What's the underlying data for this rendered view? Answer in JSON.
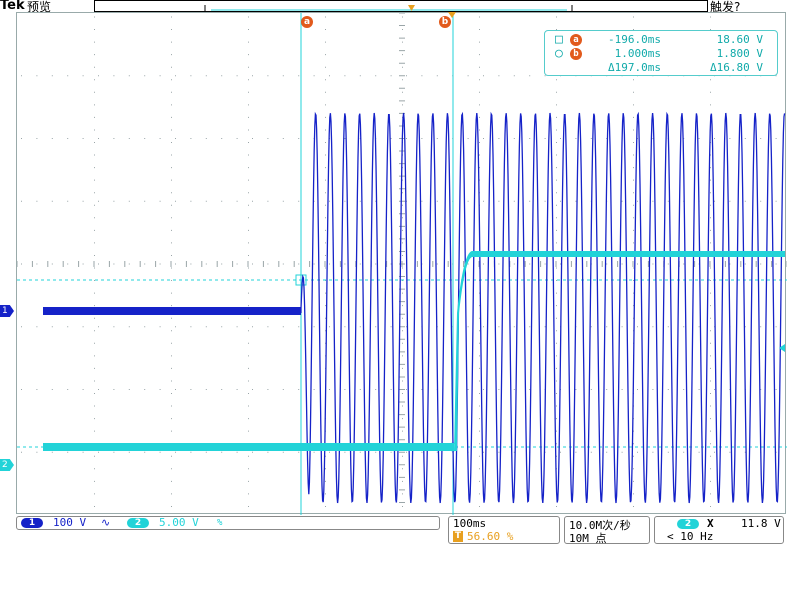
{
  "topbar": {
    "brand": "Tek",
    "mode": "预览",
    "trigger_status": "触发?"
  },
  "cursors": {
    "a": {
      "badge": "a",
      "symbol": "□",
      "time": "-196.0ms",
      "value": "18.60 V"
    },
    "b": {
      "badge": "b",
      "symbol": "○",
      "time": "1.000ms",
      "value": "1.800 V"
    },
    "delta": {
      "time": "Δ197.0ms",
      "value": "Δ16.80 V"
    }
  },
  "channels": {
    "ch1": {
      "label": "1",
      "scale": "100 V",
      "coupling": "∿",
      "color": "#1522c8"
    },
    "ch2": {
      "label": "2",
      "scale": "5.00 V",
      "extra": "%",
      "color": "#22d3d8"
    }
  },
  "horizontal": {
    "scale": "100ms",
    "trigger_mark": "T",
    "position": "56.60 %"
  },
  "acquisition": {
    "rate": "10.0M次/秒",
    "points": "10M 点"
  },
  "trigger": {
    "source": "2",
    "slope": "X",
    "level": "11.8 V",
    "freq": "< 10 Hz"
  },
  "colors": {
    "accent_orange": "#e25a1c",
    "grid": "#9aa5a8",
    "readout": "#1aa"
  }
}
